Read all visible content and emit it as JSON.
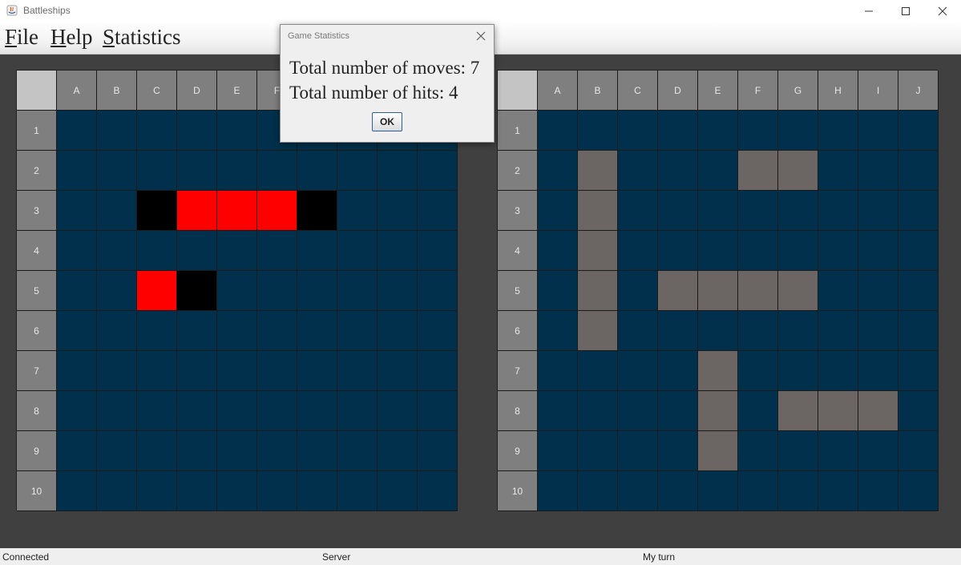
{
  "window": {
    "title": "Battleships"
  },
  "menu": [
    {
      "first": "F",
      "rest": "ile"
    },
    {
      "first": "H",
      "rest": "elp"
    },
    {
      "first": "S",
      "rest": "tatistics"
    }
  ],
  "columns": [
    "A",
    "B",
    "C",
    "D",
    "E",
    "F",
    "G",
    "H",
    "I",
    "J"
  ],
  "rows": [
    "1",
    "2",
    "3",
    "4",
    "5",
    "6",
    "7",
    "8",
    "9",
    "10"
  ],
  "left_board": {
    "grid": [
      "~~~~~~~~~~",
      "~~~~~~~~~~",
      "~~XHHHX~~~",
      "~~~~~~~~~~",
      "~~HX~~~~~~",
      "~~~~~~~~~~",
      "~~~~~~~~~~",
      "~~~~~~~~~~",
      "~~~~~~~~~~",
      "~~~~~~~~~~"
    ]
  },
  "right_board": {
    "grid": [
      "~~~~~~~~~~",
      "~S~~~SS~~~",
      "~S~~~~~~~~",
      "~S~~~~~~~~",
      "~S~SSSS~~~",
      "~S~~~~~~~~",
      "~~~~S~~~~~",
      "~~~~S~SSS~",
      "~~~~S~~~~~",
      "~~~~~~~~~~"
    ]
  },
  "cell_colors": {
    "water": "#00304b",
    "hit": "#ff0000",
    "miss": "#000000",
    "ship": "#6b6563"
  },
  "dialog": {
    "title": "Game Statistics",
    "moves_text": "Total number of moves: 7",
    "hits_text": "Total number of hits: 4",
    "ok_label": "OK"
  },
  "status": {
    "connection": "Connected",
    "role": "Server",
    "turn": "My turn"
  }
}
